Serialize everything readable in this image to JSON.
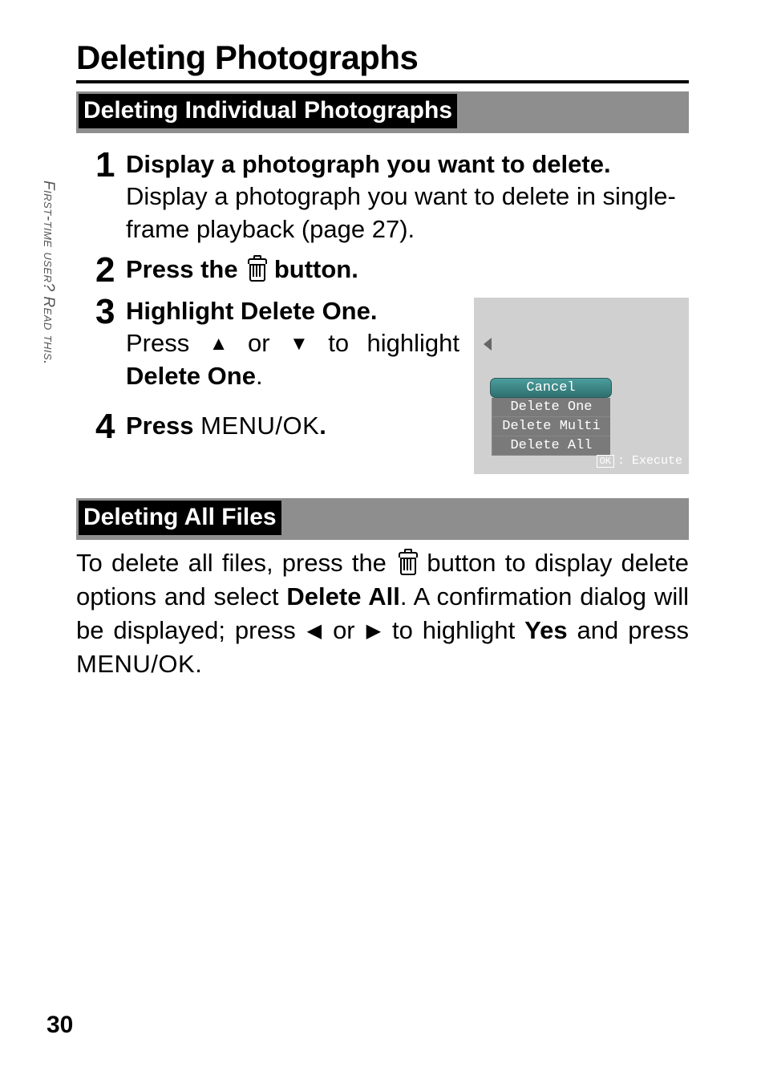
{
  "side_tab_a": "First-time user?",
  "side_tab_b": " Read this.",
  "page_number": "30",
  "h1": "Deleting Photographs",
  "sub1": "Deleting Individual Photographs",
  "sub2": "Deleting All Files",
  "steps": {
    "s1": {
      "num": "1",
      "title": "Display a photograph you want to delete.",
      "textA": "Display a photograph you want to delete in single-frame playback (page 27)."
    },
    "s2": {
      "num": "2",
      "titleA": "Press the ",
      "titleB": " button."
    },
    "s3": {
      "num": "3",
      "titleA": "Highlight ",
      "titleB": "Delete One",
      "titleC": ".",
      "textA": "Press ",
      "textB": " or ",
      "textC": " to highlight ",
      "textD": "Delete One",
      "textE": "."
    },
    "s4": {
      "num": "4",
      "titleA": "Press ",
      "titleB": "MENU/OK",
      "titleC": "."
    }
  },
  "dialog": {
    "items": [
      "Cancel",
      "Delete One",
      "Delete Multi",
      "Delete All"
    ],
    "ok": "OK",
    "execute": ": Execute"
  },
  "para2": {
    "a": "To delete all files, press the ",
    "b": " button to display delete options and select ",
    "c": "Delete All",
    "d": ". A confirmation dialog will be displayed; press ",
    "e": " or ",
    "f": " to highlight ",
    "g": "Yes",
    "h": " and press ",
    "i": "MENU/OK",
    "j": "."
  }
}
